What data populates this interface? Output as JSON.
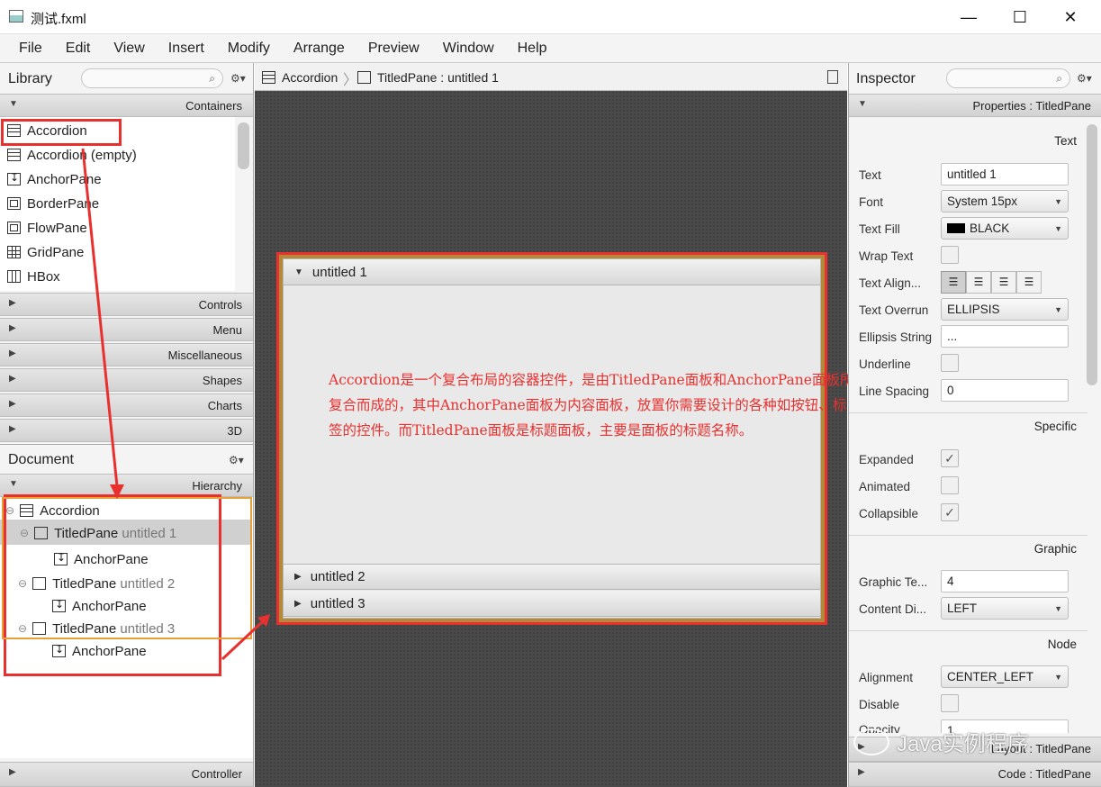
{
  "window": {
    "title": "测试.fxml",
    "minimize": "—",
    "maximize": "☐",
    "close": "✕"
  },
  "menu": [
    "File",
    "Edit",
    "View",
    "Insert",
    "Modify",
    "Arrange",
    "Preview",
    "Window",
    "Help"
  ],
  "library": {
    "title": "Library",
    "sections": {
      "containers": "Containers",
      "controls": "Controls",
      "menu": "Menu",
      "misc": "Miscellaneous",
      "shapes": "Shapes",
      "charts": "Charts",
      "threed": "3D"
    },
    "items": [
      "Accordion",
      "Accordion  (empty)",
      "AnchorPane",
      "BorderPane",
      "FlowPane",
      "GridPane",
      "HBox"
    ]
  },
  "document": {
    "title": "Document",
    "hierarchy_label": "Hierarchy",
    "controller_label": "Controller",
    "tree": {
      "root": "Accordion",
      "tp1": "TitledPane",
      "tp1_name": "untitled 1",
      "ap1": "AnchorPane",
      "tp2": "TitledPane",
      "tp2_name": "untitled 2",
      "ap2": "AnchorPane",
      "tp3": "TitledPane",
      "tp3_name": "untitled 3",
      "ap3": "AnchorPane"
    }
  },
  "breadcrumb": {
    "first": "Accordion",
    "second": "TitledPane : untitled 1"
  },
  "canvas": {
    "pane1": "untitled 1",
    "pane2": "untitled 2",
    "pane3": "untitled 3",
    "annotation": "Accordion是一个复合布局的容器控件，是由TitledPane面板和AnchorPane面板所复合而成的，其中AnchorPane面板为内容面板，放置你需要设计的各种如按钮、标签的控件。而TitledPane面板是标题面板，主要是面板的标题名称。"
  },
  "inspector": {
    "title": "Inspector",
    "properties_header": "Properties : TitledPane",
    "layout_header": "Layout : TitledPane",
    "code_header": "Code : TitledPane",
    "sections": {
      "text": "Text",
      "specific": "Specific",
      "graphic": "Graphic",
      "node": "Node"
    },
    "text_label": "Text",
    "text_value": "untitled 1",
    "font_label": "Font",
    "font_value": "System 15px",
    "fill_label": "Text Fill",
    "fill_value": "BLACK",
    "wrap_label": "Wrap Text",
    "align_label": "Text Align...",
    "overrun_label": "Text Overrun",
    "overrun_value": "ELLIPSIS",
    "ellipsis_label": "Ellipsis String",
    "ellipsis_value": "...",
    "underline_label": "Underline",
    "spacing_label": "Line Spacing",
    "spacing_value": "0",
    "expanded_label": "Expanded",
    "animated_label": "Animated",
    "collapsible_label": "Collapsible",
    "gtext_label": "Graphic Te...",
    "gtext_value": "4",
    "content_label": "Content Di...",
    "content_value": "LEFT",
    "alignment_label": "Alignment",
    "alignment_value": "CENTER_LEFT",
    "disable_label": "Disable",
    "opacity_label": "Opacity",
    "opacity_value": "1"
  },
  "watermark": "Java实例程序",
  "colors": {
    "highlight": "#e8312f",
    "selection_border": "#e8a03a",
    "canvas_bg": "#4a4a4a"
  }
}
